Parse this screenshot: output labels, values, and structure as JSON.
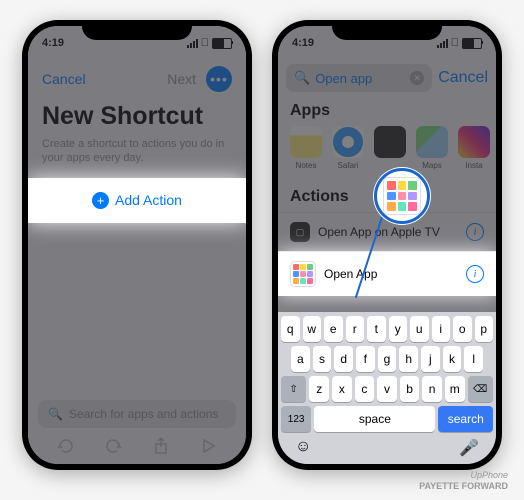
{
  "status": {
    "time": "4:19"
  },
  "phone1": {
    "nav": {
      "cancel": "Cancel",
      "next": "Next"
    },
    "title": "New Shortcut",
    "subtitle": "Create a shortcut to actions you do in your apps every day.",
    "add_action": "Add Action",
    "search_placeholder": "Search for apps and actions"
  },
  "phone2": {
    "search_value": "Open app",
    "cancel": "Cancel",
    "apps_header": "Apps",
    "apps": [
      {
        "label": "Notes"
      },
      {
        "label": "Safari"
      },
      {
        "label": ""
      },
      {
        "label": "Maps"
      },
      {
        "label": "Insta"
      }
    ],
    "actions_header": "Actions",
    "actions": [
      {
        "label": "Open App on Apple TV"
      },
      {
        "label": "Open App"
      }
    ],
    "keyboard": {
      "row1": [
        "q",
        "w",
        "e",
        "r",
        "t",
        "y",
        "u",
        "i",
        "o",
        "p"
      ],
      "row2": [
        "a",
        "s",
        "d",
        "f",
        "g",
        "h",
        "j",
        "k",
        "l"
      ],
      "row3": [
        "⇧",
        "z",
        "x",
        "c",
        "v",
        "b",
        "n",
        "m",
        "⌫"
      ],
      "bottom": {
        "num": "123",
        "space": "space",
        "search": "search"
      }
    }
  },
  "credit": {
    "line1": "UpPhone",
    "line2": "PAYETTE FORWARD"
  }
}
